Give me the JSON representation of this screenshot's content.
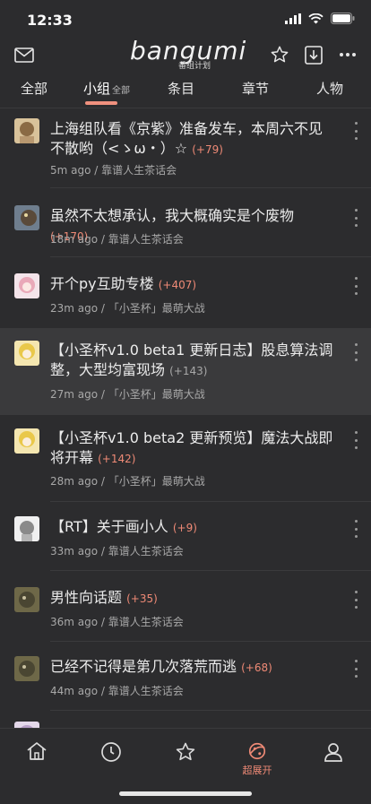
{
  "status": {
    "time": "12:33"
  },
  "header": {
    "logo": "bangumi",
    "logo_sub": "番组计划"
  },
  "tabs": [
    {
      "label": "全部"
    },
    {
      "label": "小组",
      "sub": "全部",
      "active": true
    },
    {
      "label": "条目"
    },
    {
      "label": "章节"
    },
    {
      "label": "人物"
    }
  ],
  "topics": [
    {
      "title": "上海组队看《京紫》准备发车，本周六不见不散哟（<ゝω・）☆",
      "replies": "(+79)",
      "time": "5m ago",
      "group": "靠谱人生茶话会"
    },
    {
      "title": "虽然不太想承认，我大概确实是个废物",
      "replies": "(+170)",
      "time": "18m ago",
      "group": "靠谱人生茶话会"
    },
    {
      "title": "开个py互助专楼",
      "replies": "(+407)",
      "time": "23m ago",
      "group": "「小圣杯」最萌大战"
    },
    {
      "title": "【小圣杯v1.0 beta1 更新日志】股息算法调整，大型均富现场",
      "replies": "(+143)",
      "time": "27m ago",
      "group": "「小圣杯」最萌大战"
    },
    {
      "title": "【小圣杯v1.0 beta2 更新预览】魔法大战即将开幕",
      "replies": "(+142)",
      "time": "28m ago",
      "group": "「小圣杯」最萌大战"
    },
    {
      "title": "【RT】关于画小人",
      "replies": "(+9)",
      "time": "33m ago",
      "group": "靠谱人生茶话会"
    },
    {
      "title": "男性向话题",
      "replies": "(+35)",
      "time": "36m ago",
      "group": "靠谱人生茶话会"
    },
    {
      "title": "已经不记得是第几次落荒而逃",
      "replies": "(+68)",
      "time": "44m ago",
      "group": "靠谱人生茶话会"
    }
  ],
  "tabbar": {
    "active_label": "超展开"
  },
  "colors": {
    "background": "#2c2c2e",
    "accent": "#ef8a76",
    "highlight_row": "#3a3a3c"
  }
}
